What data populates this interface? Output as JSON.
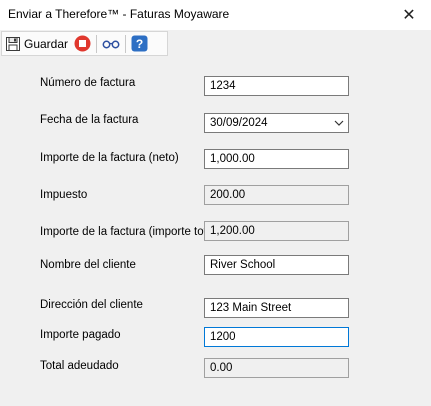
{
  "window": {
    "title": "Enviar a Therefore™ - Faturas Moyaware",
    "close_glyph": "✕"
  },
  "toolbar": {
    "save_label": "Guardar",
    "icons": [
      "save-icon",
      "stop-icon",
      "glasses-icon",
      "help-icon"
    ],
    "stop_color": "#e0382e",
    "help_color": "#2d6fc4"
  },
  "form": {
    "fields": [
      {
        "label": "Número de factura",
        "value": "1234"
      },
      {
        "label": "Fecha de la factura",
        "value": "30/09/2024"
      },
      {
        "label": "Importe de la factura (neto)",
        "value": "1,000.00"
      },
      {
        "label": "Impuesto",
        "value": "200.00"
      },
      {
        "label": "Importe de la factura (importe total)",
        "value": "1,200.00"
      },
      {
        "label": "Nombre del cliente",
        "value": "River School"
      },
      {
        "label": "Dirección del cliente",
        "value": "123 Main Street"
      },
      {
        "label": "Importe pagado",
        "value": "1200"
      },
      {
        "label": "Total adeudado",
        "value": "0.00"
      }
    ]
  }
}
